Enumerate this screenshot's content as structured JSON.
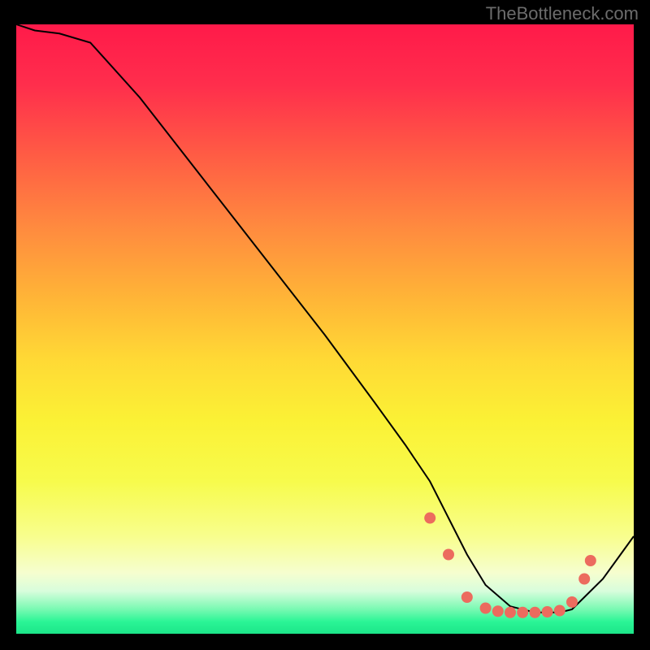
{
  "watermark": "TheBottleneck.com",
  "chart_data": {
    "type": "line",
    "title": "",
    "xlabel": "",
    "ylabel": "",
    "xlim": [
      0,
      100
    ],
    "ylim": [
      0,
      100
    ],
    "series": [
      {
        "name": "curve",
        "x": [
          0,
          3,
          7,
          12,
          20,
          30,
          40,
          50,
          58,
          63,
          67,
          70,
          73,
          76,
          80,
          84,
          88,
          90,
          92,
          95,
          100
        ],
        "y": [
          100,
          99,
          98.5,
          97,
          88,
          75,
          62,
          49,
          38,
          31,
          25,
          19,
          13,
          8,
          4.5,
          3.5,
          3.5,
          4,
          6,
          9,
          16
        ],
        "color": "#000000",
        "width": 2
      }
    ],
    "points": [
      {
        "x": 67,
        "y": 19,
        "color": "#ec6b5e",
        "r": 7
      },
      {
        "x": 70,
        "y": 13,
        "color": "#ec6b5e",
        "r": 7
      },
      {
        "x": 73,
        "y": 6,
        "color": "#ec6b5e",
        "r": 7
      },
      {
        "x": 76,
        "y": 4.2,
        "color": "#ec6b5e",
        "r": 7
      },
      {
        "x": 78,
        "y": 3.7,
        "color": "#ec6b5e",
        "r": 7
      },
      {
        "x": 80,
        "y": 3.5,
        "color": "#ec6b5e",
        "r": 7
      },
      {
        "x": 82,
        "y": 3.5,
        "color": "#ec6b5e",
        "r": 7
      },
      {
        "x": 84,
        "y": 3.5,
        "color": "#ec6b5e",
        "r": 7
      },
      {
        "x": 86,
        "y": 3.6,
        "color": "#ec6b5e",
        "r": 7
      },
      {
        "x": 88,
        "y": 3.8,
        "color": "#ec6b5e",
        "r": 7
      },
      {
        "x": 90,
        "y": 5.2,
        "color": "#ec6b5e",
        "r": 7
      },
      {
        "x": 92,
        "y": 9,
        "color": "#ec6b5e",
        "r": 7
      },
      {
        "x": 93,
        "y": 12,
        "color": "#ec6b5e",
        "r": 7
      }
    ]
  }
}
